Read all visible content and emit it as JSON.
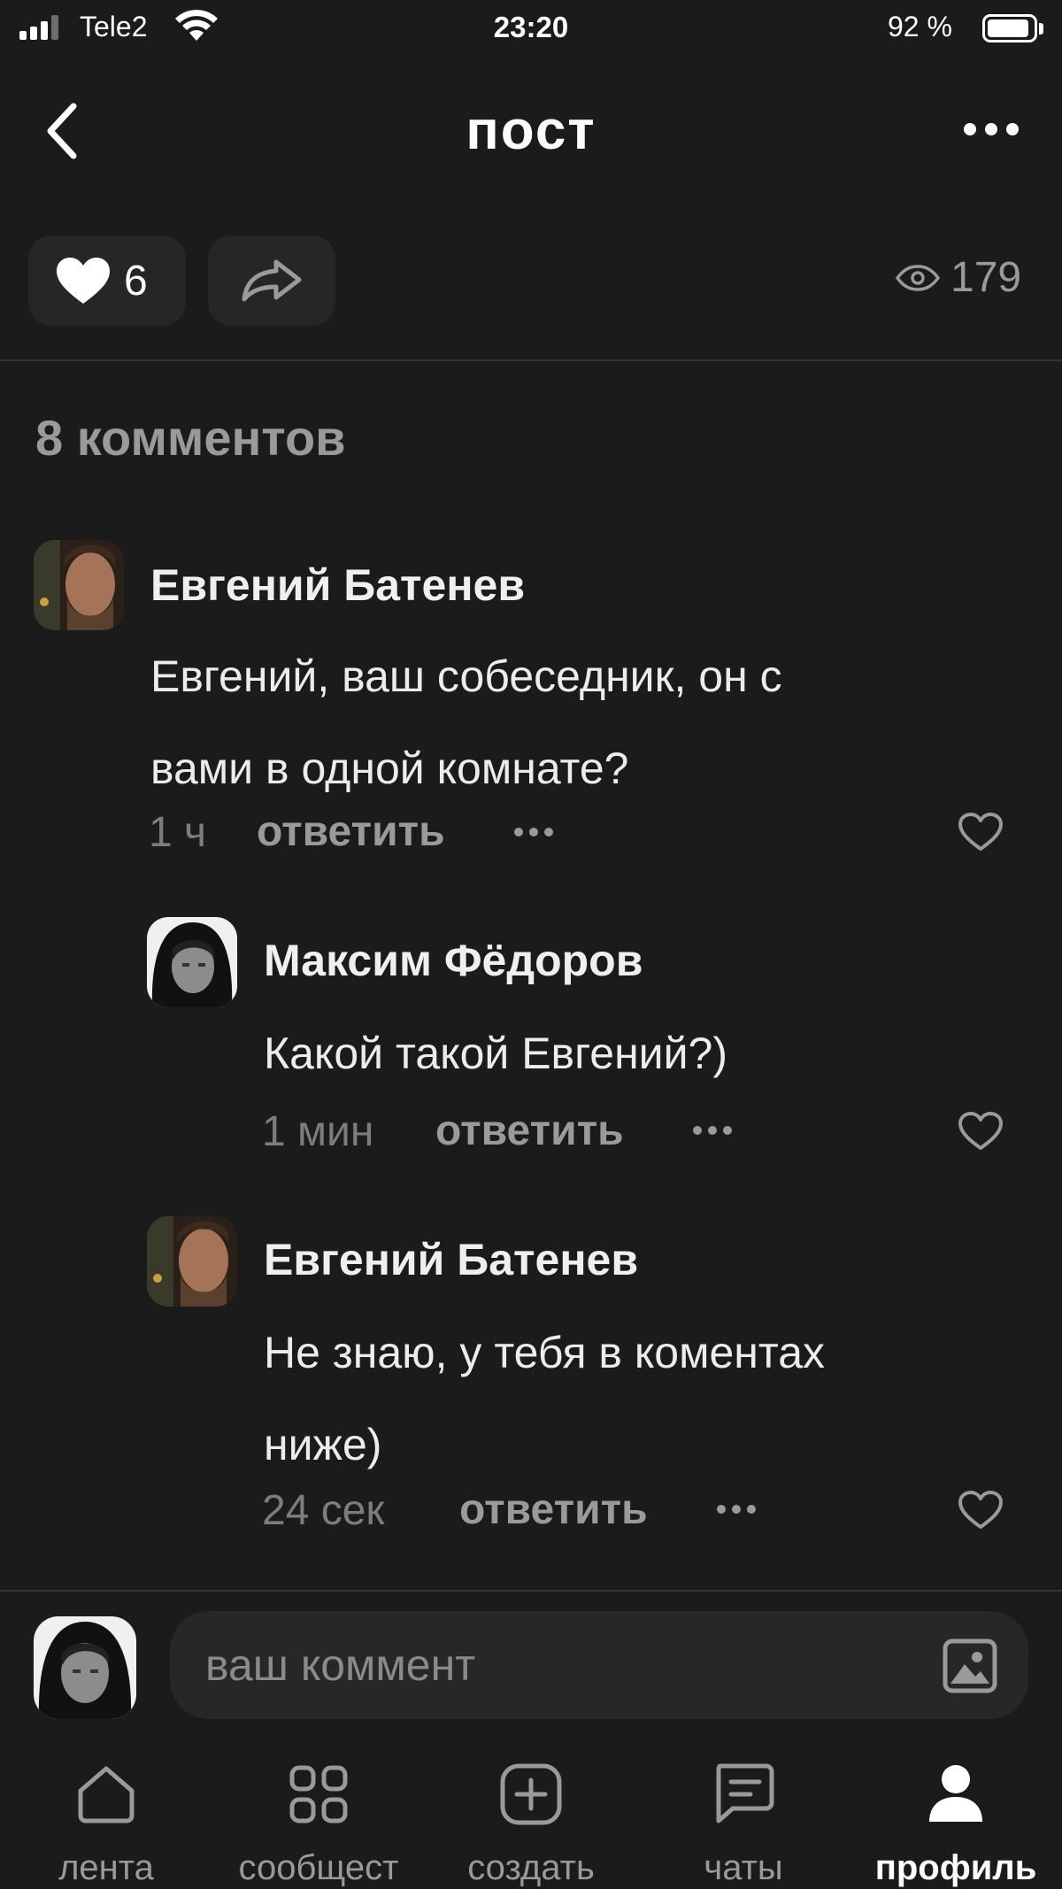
{
  "status_bar": {
    "carrier": "Tele2",
    "time": "23:20",
    "battery": "92 %",
    "battery_level": 0.92,
    "signal_bars_active": 3
  },
  "header": {
    "title": "пост"
  },
  "post_actions": {
    "likes": "6",
    "views": "179"
  },
  "comments_section": {
    "count_label": "8 комментов",
    "comments": [
      {
        "author": "Евгений Батенев",
        "text_lines": [
          "Евгений, ваш собеседник, он с",
          "вами в одной комнате?"
        ],
        "time": "1 ч",
        "reply_label": "ответить"
      },
      {
        "author": "Максим Фёдоров",
        "text_lines": [
          "Какой такой Евгений?)"
        ],
        "time": "1 мин",
        "reply_label": "ответить"
      },
      {
        "author": "Евгений Батенев",
        "text_lines": [
          "Не знаю, у тебя в коментах",
          "ниже)"
        ],
        "time": "24 сек",
        "reply_label": "ответить"
      }
    ]
  },
  "comment_input": {
    "placeholder": "ваш коммент"
  },
  "tab_bar": {
    "tabs": [
      {
        "label": "лента",
        "icon": "home-icon"
      },
      {
        "label": "сообщест",
        "icon": "grid-icon"
      },
      {
        "label": "создать",
        "icon": "plus-icon"
      },
      {
        "label": "чаты",
        "icon": "chat-icon"
      },
      {
        "label": "профиль",
        "icon": "person-icon",
        "active": true
      }
    ]
  },
  "colors": {
    "background": "#1b1b1c",
    "chip": "#262627",
    "muted_text": "#9a9a9a",
    "primary_text": "#f2f2f2"
  }
}
